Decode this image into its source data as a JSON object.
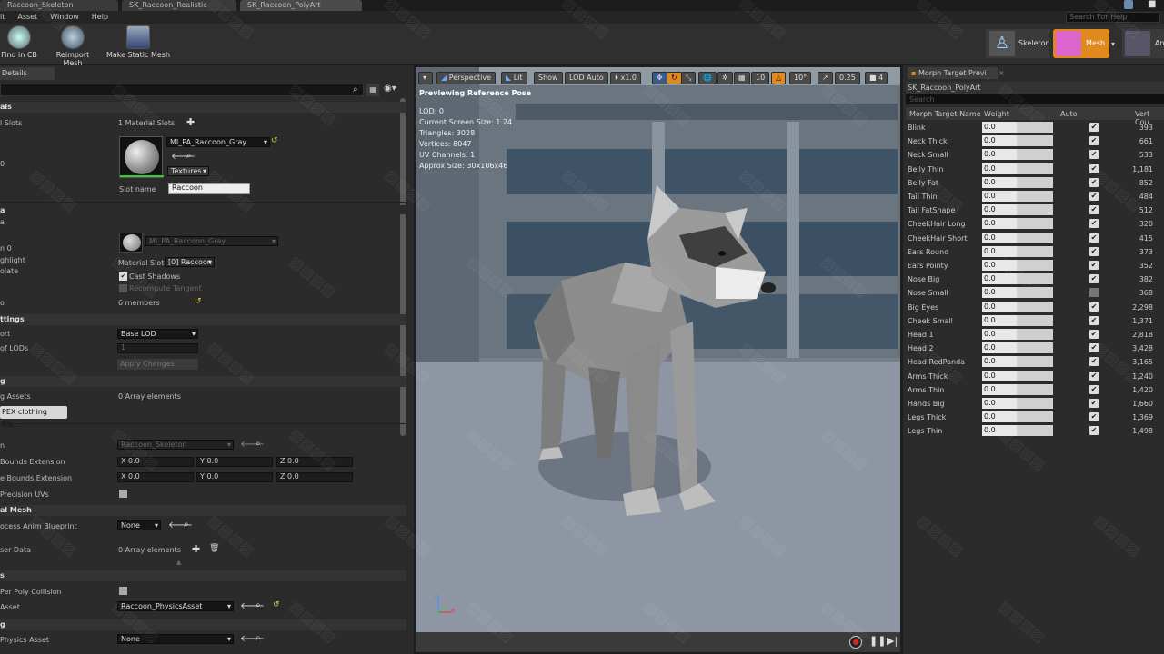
{
  "tabs": [
    "Raccoon_Skeleton",
    "SK_Raccoon_Realistic",
    "SK_Raccoon_PolyArt"
  ],
  "menu": [
    "it",
    "Asset",
    "Window",
    "Help"
  ],
  "search_help_placeholder": "Search For Help",
  "toolbar": {
    "find_in_cb": "Find in CB",
    "reimport": "Reimport Mesh",
    "make_static": "Make Static Mesh"
  },
  "modes": {
    "skeleton": "Skeleton",
    "mesh": "Mesh",
    "anim": "An"
  },
  "details": {
    "tab": "Details",
    "materials_header": "als",
    "slots_label": "l Slots",
    "slots_count": "1 Material Slots",
    "slot_zero": "0",
    "material_name": "MI_PA_Raccoon_Gray",
    "textures": "Textures",
    "slot_name_label": "Slot name",
    "slot_name_value": "Raccoon",
    "lod_header": "a",
    "lod_label": "n 0",
    "highlight": "ghlight",
    "isolate": "olate",
    "lod_material": "MI_PA_Raccoon_Gray",
    "material_slot_label": "Material Slot",
    "material_slot_value": "[0] Raccoon",
    "cast_shadows": "Cast Shadows",
    "recompute": "Recompute Tangent",
    "sections_label": "o",
    "members": "6 members",
    "lod_settings": "ttings",
    "import_label": "ort",
    "base_lod": "Base LOD",
    "num_lods_label": "of LODs",
    "num_lods": "1",
    "apply": "Apply Changes",
    "clothing_header": "g",
    "assets_label": "g Assets",
    "array0": "0 Array elements",
    "apex": "PEX clothing file...",
    "skeleton_label": "n",
    "skeleton_value": "Raccoon_Skeleton",
    "pos_bounds": "Bounds Extension",
    "neg_bounds": "e Bounds Extension",
    "precision_uvs": "Precision UVs",
    "x": "X",
    "y": "Y",
    "z": "Z",
    "zero": "0.0",
    "skel_mesh_header": "al Mesh",
    "post_process": "ocess Anim Blueprint",
    "none": "None",
    "user_data": "ser Data",
    "array0b": "0 Array elements",
    "physics_header": "s",
    "per_poly": "Per Poly Collision",
    "phys_asset_label": "Asset",
    "phys_asset": "Raccoon_PhysicsAsset",
    "lighting_header": "g",
    "shadow_phys_label": "Physics Asset",
    "shadow_phys": "None"
  },
  "viewport": {
    "perspective": "Perspective",
    "lit": "Lit",
    "show": "Show",
    "lod_auto": "LOD Auto",
    "speed": "x1.0",
    "grid": "10",
    "angle": "10°",
    "scale": "0.25",
    "cam": "4",
    "preview": "Previewing Reference Pose",
    "stats": [
      "LOD: 0",
      "Current Screen Size: 1.24",
      "Triangles: 3028",
      "Vertices: 8047",
      "UV Channels: 1",
      "Approx Size: 30x106x46"
    ]
  },
  "morph": {
    "tab": "Morph Target Previ",
    "asset": "SK_Raccoon_PolyArt",
    "search": "Search",
    "cols": [
      "Morph Target Name",
      "Weight",
      "Auto",
      "Vert Cou"
    ],
    "rows": [
      {
        "name": "Blink",
        "w": "0.0",
        "auto": true,
        "v": "393"
      },
      {
        "name": "Neck Thick",
        "w": "0.0",
        "auto": true,
        "v": "661"
      },
      {
        "name": "Neck Small",
        "w": "0.0",
        "auto": true,
        "v": "533"
      },
      {
        "name": "Belly Thin",
        "w": "0.0",
        "auto": true,
        "v": "1,181"
      },
      {
        "name": "Belly Fat",
        "w": "0.0",
        "auto": true,
        "v": "852"
      },
      {
        "name": "Tail Thin",
        "w": "0.0",
        "auto": true,
        "v": "484"
      },
      {
        "name": "Tail FatShape",
        "w": "0.0",
        "auto": true,
        "v": "512"
      },
      {
        "name": "CheekHair Long",
        "w": "0.0",
        "auto": true,
        "v": "320"
      },
      {
        "name": "CheekHair Short",
        "w": "0.0",
        "auto": true,
        "v": "415"
      },
      {
        "name": "Ears Round",
        "w": "0.0",
        "auto": true,
        "v": "373"
      },
      {
        "name": "Ears Pointy",
        "w": "0.0",
        "auto": true,
        "v": "352"
      },
      {
        "name": "Nose Big",
        "w": "0.0",
        "auto": true,
        "v": "382"
      },
      {
        "name": "Nose Small",
        "w": "0.0",
        "auto": false,
        "v": "368"
      },
      {
        "name": "Big Eyes",
        "w": "0.0",
        "auto": true,
        "v": "2,298"
      },
      {
        "name": "Cheek Small",
        "w": "0.0",
        "auto": true,
        "v": "1,371"
      },
      {
        "name": "Head 1",
        "w": "0.0",
        "auto": true,
        "v": "2,818"
      },
      {
        "name": "Head 2",
        "w": "0.0",
        "auto": true,
        "v": "3,428"
      },
      {
        "name": "Head RedPanda",
        "w": "0.0",
        "auto": true,
        "v": "3,165"
      },
      {
        "name": "Arms Thick",
        "w": "0.0",
        "auto": true,
        "v": "1,240"
      },
      {
        "name": "Arms Thin",
        "w": "0.0",
        "auto": true,
        "v": "1,420"
      },
      {
        "name": "Hands Big",
        "w": "0.0",
        "auto": true,
        "v": "1,660"
      },
      {
        "name": "Legs Thick",
        "w": "0.0",
        "auto": true,
        "v": "1,369"
      },
      {
        "name": "Legs Thin",
        "w": "0.0",
        "auto": true,
        "v": "1,498"
      }
    ]
  }
}
